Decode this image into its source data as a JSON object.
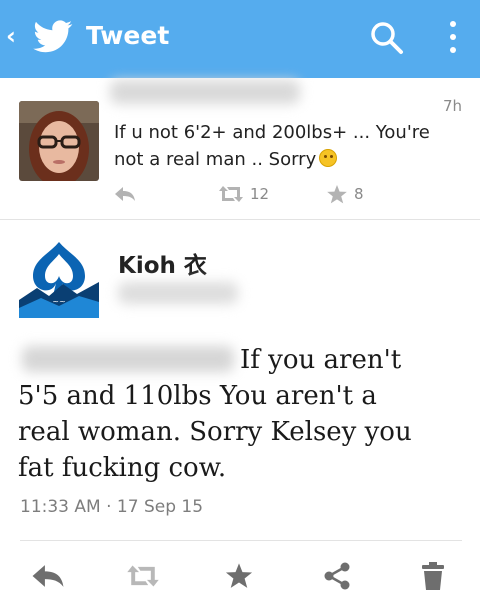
{
  "app_bar": {
    "back_glyph": "‹",
    "title": "Tweet",
    "icons": [
      "twitter-bird-icon",
      "search-icon",
      "overflow-menu-icon"
    ],
    "color": "#55acee"
  },
  "parent_tweet": {
    "time": "7h",
    "text_line1": "If u not 6'2+ and 200lbs+ ... You're",
    "text_line2": "not a real man .. Sorry",
    "emoji": "confused-face",
    "retweets": "12",
    "favorites": "8"
  },
  "main_tweet": {
    "display_name": "Kioh 衣",
    "text_line1": "If you aren't",
    "text_line2": "5'5 and 110lbs You aren't a",
    "text_line3": "real woman. Sorry Kelsey you",
    "text_line4": "fat fucking cow.",
    "timestamp": "11:33 AM · 17 Sep 15"
  },
  "action_bar": {
    "icons": [
      "reply-icon",
      "retweet-icon",
      "favorite-icon",
      "share-icon",
      "delete-icon"
    ]
  }
}
